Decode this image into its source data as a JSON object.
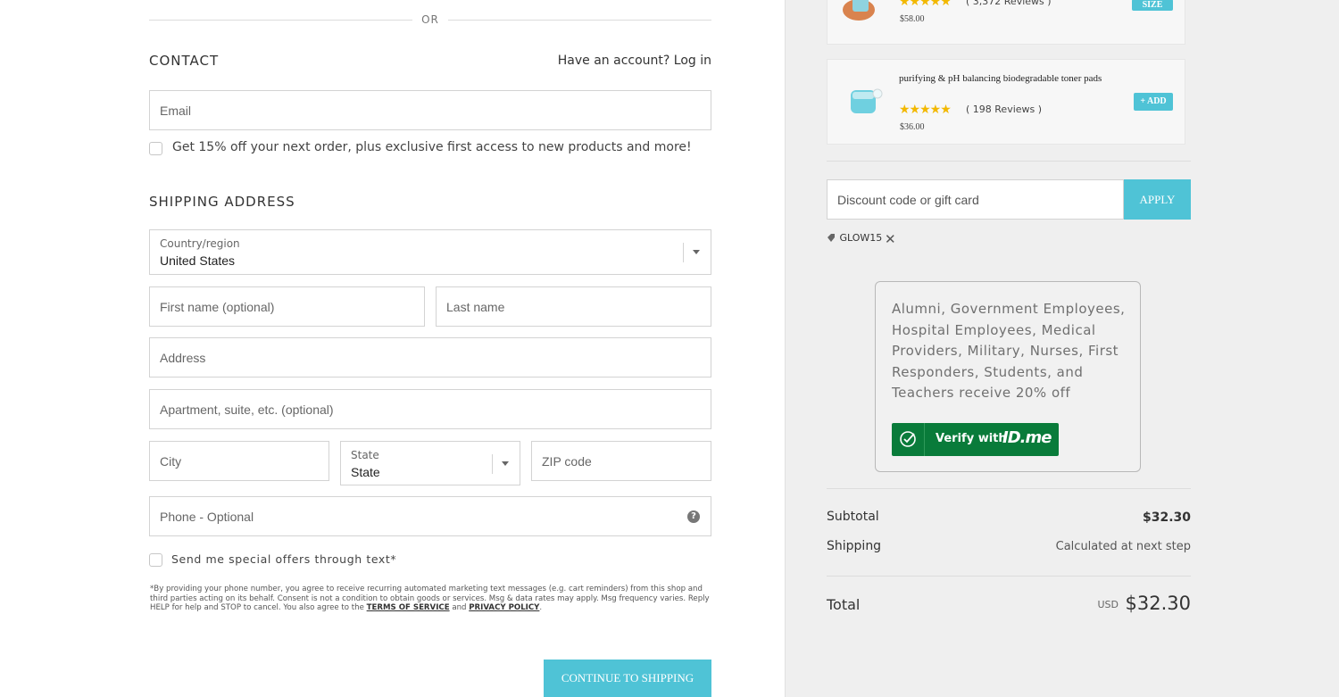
{
  "divider": {
    "or_label": "OR"
  },
  "contact": {
    "title": "CONTACT",
    "have_account": "Have an account?",
    "login_link": "Log in",
    "email_placeholder": "Email",
    "offer_checkbox_label": "Get 15% off your next order, plus exclusive first access to new products and more!"
  },
  "shipping": {
    "title": "SHIPPING ADDRESS",
    "country_label": "Country/region",
    "country_value": "United States",
    "first_name_placeholder": "First name (optional)",
    "last_name_placeholder": "Last name",
    "address_placeholder": "Address",
    "apartment_placeholder": "Apartment, suite, etc. (optional)",
    "city_placeholder": "City",
    "state_label": "State",
    "state_value": "State",
    "zip_placeholder": "ZIP code",
    "phone_placeholder": "Phone - Optional",
    "sms_checkbox_label": "Send me special offers through text*",
    "legal_text": "*By providing your phone number, you agree to receive recurring automated marketing text messages (e.g. cart reminders) from this shop and third parties acting on its behalf. Consent is not a condition to obtain goods or services. Msg & data rates may apply. Msg frequency varies. Reply HELP for help and STOP to cancel. You also agree to the",
    "terms_link": "TERMS OF SERVICE",
    "and_text": "and",
    "privacy_link": "PRIVACY POLICY",
    "continue_button": "CONTINUE TO SHIPPING"
  },
  "upsell": [
    {
      "reviews": "( 3,372 Reviews )",
      "price": "$58.00",
      "button": "SIZE",
      "stars": "★★★★★"
    },
    {
      "name": "purifying & pH balancing biodegradable toner pads",
      "reviews": "( 198 Reviews )",
      "price": "$36.00",
      "button": "+ ADD",
      "stars": "★★★★★"
    }
  ],
  "discount": {
    "placeholder": "Discount code or gift card",
    "apply_button": "APPLY",
    "applied_code": "GLOW15"
  },
  "idme": {
    "text": "Alumni, Government Employees, Hospital Employees, Medical Providers, Military, Nurses, First Responders, Students, and Teachers receive 20% off",
    "button_text": "Verify with",
    "brand": "ID.me"
  },
  "summary": {
    "subtotal_label": "Subtotal",
    "subtotal_value": "$32.30",
    "shipping_label": "Shipping",
    "shipping_value": "Calculated at next step",
    "total_label": "Total",
    "currency": "USD",
    "total_value": "$32.30"
  },
  "colors": {
    "accent": "#4fc3d6",
    "idme_green": "#097b3a",
    "star": "#f2b800"
  }
}
